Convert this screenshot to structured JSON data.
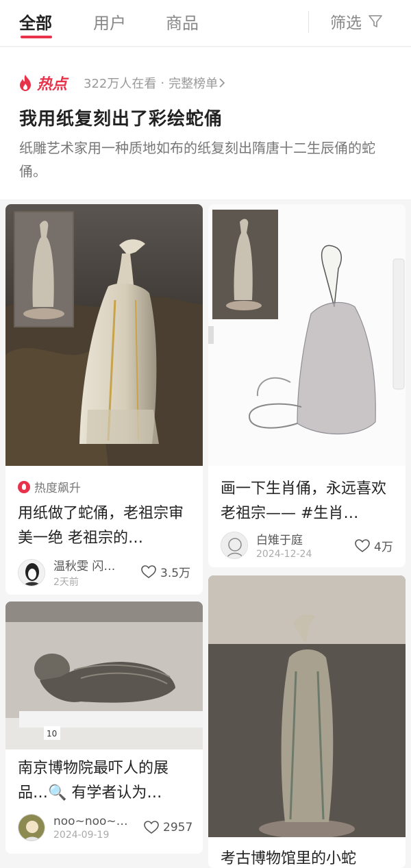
{
  "tabs": {
    "all": "全部",
    "users": "用户",
    "goods": "商品",
    "filter": "筛选"
  },
  "hot": {
    "label": "热点",
    "viewers": "322万人在看",
    "separator": "·",
    "full_list": "完整榜单",
    "title": "我用纸复刻出了彩绘蛇俑",
    "description": "纸雕艺术家用一种质地如布的纸复刻出隋唐十二生辰俑的蛇俑。"
  },
  "cards": [
    {
      "trend_label": "热度飙升",
      "title": "用纸做了蛇俑，老祖宗审美一绝 老祖宗的…",
      "author": "温秋雯 闪…",
      "date": "2天前",
      "likes": "3.5万"
    },
    {
      "title": "画一下生肖俑，永远喜欢老祖宗—— #生肖…",
      "author": "白雉于庭",
      "date": "2024-12-24",
      "likes": "4万"
    },
    {
      "title": "南京博物院最吓人的展品…🔍 有学者认为…",
      "author": "noo~noo~…",
      "date": "2024-09-19",
      "likes": "2957",
      "image_label": "10"
    },
    {
      "title": "考古博物馆里的小蛇"
    }
  ],
  "colors": {
    "accent": "#e8324a",
    "text_primary": "#222222",
    "text_secondary": "#999999"
  }
}
